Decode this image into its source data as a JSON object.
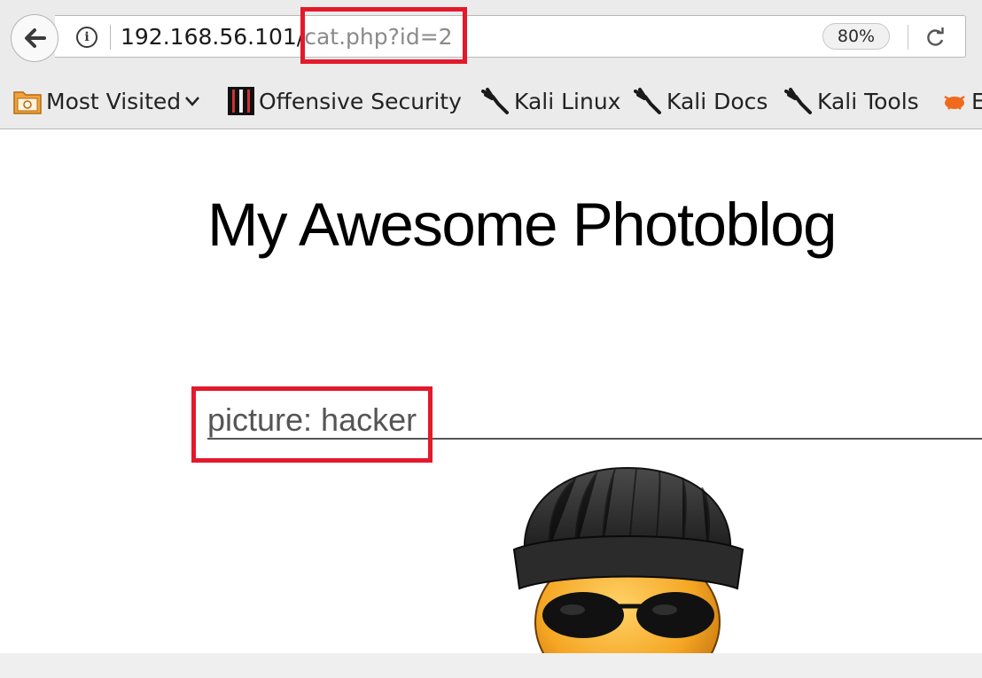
{
  "browser": {
    "url_host": "192.168.56.101/",
    "url_path": "cat.php?id=2",
    "zoom": "80%"
  },
  "bookmarks": [
    {
      "label": "Most Visited",
      "icon": "folder-icon"
    },
    {
      "label": "Offensive Security",
      "icon": "offensive-security-icon"
    },
    {
      "label": "Kali Linux",
      "icon": "kali-dragon-icon"
    },
    {
      "label": "Kali Docs",
      "icon": "kali-dragon-icon"
    },
    {
      "label": "Kali Tools",
      "icon": "kali-dragon-icon"
    },
    {
      "label": "E",
      "icon": "exploit-db-icon"
    }
  ],
  "page": {
    "title": "My Awesome Photoblog",
    "picture_label": "picture: hacker"
  },
  "colors": {
    "highlight": "#e3192c",
    "chrome": "#ebebeb"
  }
}
